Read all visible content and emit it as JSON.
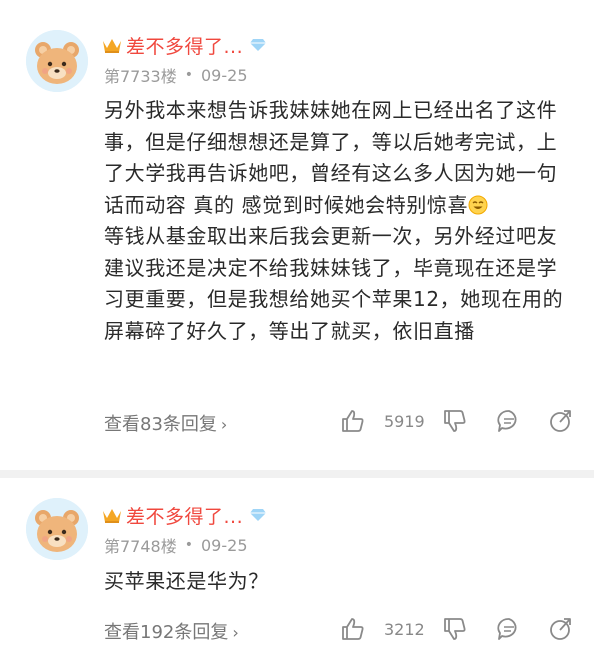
{
  "posts": [
    {
      "username": "差不多得了...",
      "floor": "第7733楼",
      "date": "09-25",
      "paragraph1": "另外我本来想告诉我妹妹她在网上已经出名了这件事，但是仔细想想还是算了，等以后她考完试，上了大学我再告诉她吧，曾经有这么多人因为她一句话而动容 真的 感觉到时候她会特别惊喜",
      "paragraph2": "等钱从基金取出来后我会更新一次，另外经过吧友建议我还是决定不给我妹妹钱了，毕竟现在还是学习更重要，但是我想给她买个苹果12，她现在用的屏幕碎了好久了，等出了就买，依旧直播",
      "view_replies": "查看83条回复",
      "likes": "5919"
    },
    {
      "username": "差不多得了...",
      "floor": "第7748楼",
      "date": "09-25",
      "paragraph1": "买苹果还是华为？",
      "view_replies": "查看192条回复",
      "likes": "3212"
    }
  ],
  "colors": {
    "username": "#f0483e",
    "meta": "#9a9a9a",
    "icon": "#8a8a8a"
  },
  "icons": [
    "crown-icon",
    "diamond-icon",
    "smile-emoji-icon",
    "thumbs-up-icon",
    "thumbs-down-icon",
    "comment-icon",
    "share-icon",
    "chevron-right-icon"
  ]
}
